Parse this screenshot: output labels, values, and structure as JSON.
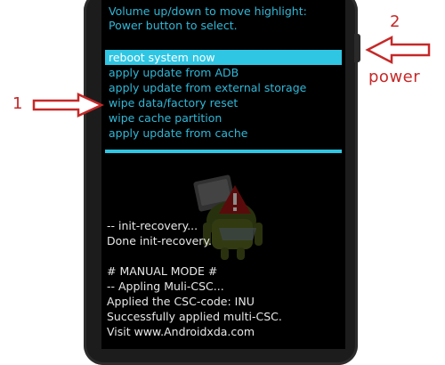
{
  "screen": {
    "instructions": [
      "Volume up/down to move highlight:",
      "Power button to select."
    ],
    "menu": [
      {
        "label": "reboot system now",
        "selected": true
      },
      {
        "label": "apply update from ADB",
        "selected": false
      },
      {
        "label": "apply update from external storage",
        "selected": false
      },
      {
        "label": "wipe data/factory reset",
        "selected": false
      },
      {
        "label": "wipe cache partition",
        "selected": false
      },
      {
        "label": "apply update from cache",
        "selected": false
      }
    ],
    "log_init": [
      "-- init-recovery...",
      "Done init-recovery."
    ],
    "log_csc": [
      "# MANUAL MODE #",
      "-- Appling Muli-CSC...",
      "Applied the CSC-code: INU",
      "Successfully applied multi-CSC.",
      "Visit www.Androidxda.com"
    ]
  },
  "annotations": {
    "left_number": "1",
    "right_number": "2",
    "right_label": "power",
    "color": "#c62828"
  },
  "colors": {
    "highlight": "#2fc6e4",
    "menu_text": "#2fb8d8",
    "log_text": "#e8e8e8",
    "screen_bg": "#000000"
  }
}
